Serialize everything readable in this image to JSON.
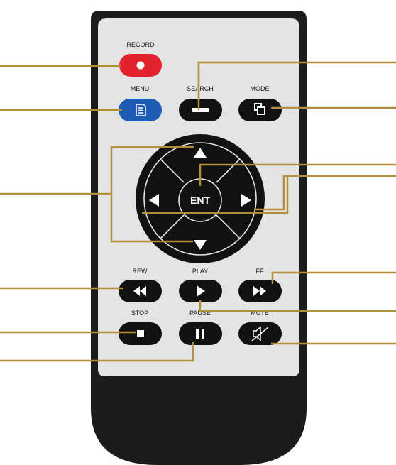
{
  "colors": {
    "remote_body": "#1c1c1c",
    "remote_panel": "#e4e4e4",
    "button": "#111111",
    "record_button": "#e0232d",
    "menu_button": "#1e5bb5",
    "leader_lines": "#b38f3a"
  },
  "labels": {
    "record": "RECORD",
    "menu": "MENU",
    "search": "SEARCH",
    "mode": "MODE",
    "ent": "ENT",
    "rew": "REW",
    "play": "PLAY",
    "ff": "FF",
    "stop": "STOP",
    "pause": "PAUSE",
    "mute": "MUTE"
  },
  "icons": {
    "record": "record-dot-icon",
    "menu": "document-icon",
    "search": "minus-icon",
    "mode": "overlap-squares-icon",
    "up": "triangle-up-icon",
    "down": "triangle-down-icon",
    "left": "triangle-left-icon",
    "right": "triangle-right-icon",
    "rew": "rewind-icon",
    "play": "play-icon",
    "ff": "fast-forward-icon",
    "stop": "stop-icon",
    "pause": "pause-icon",
    "mute": "mute-icon"
  }
}
